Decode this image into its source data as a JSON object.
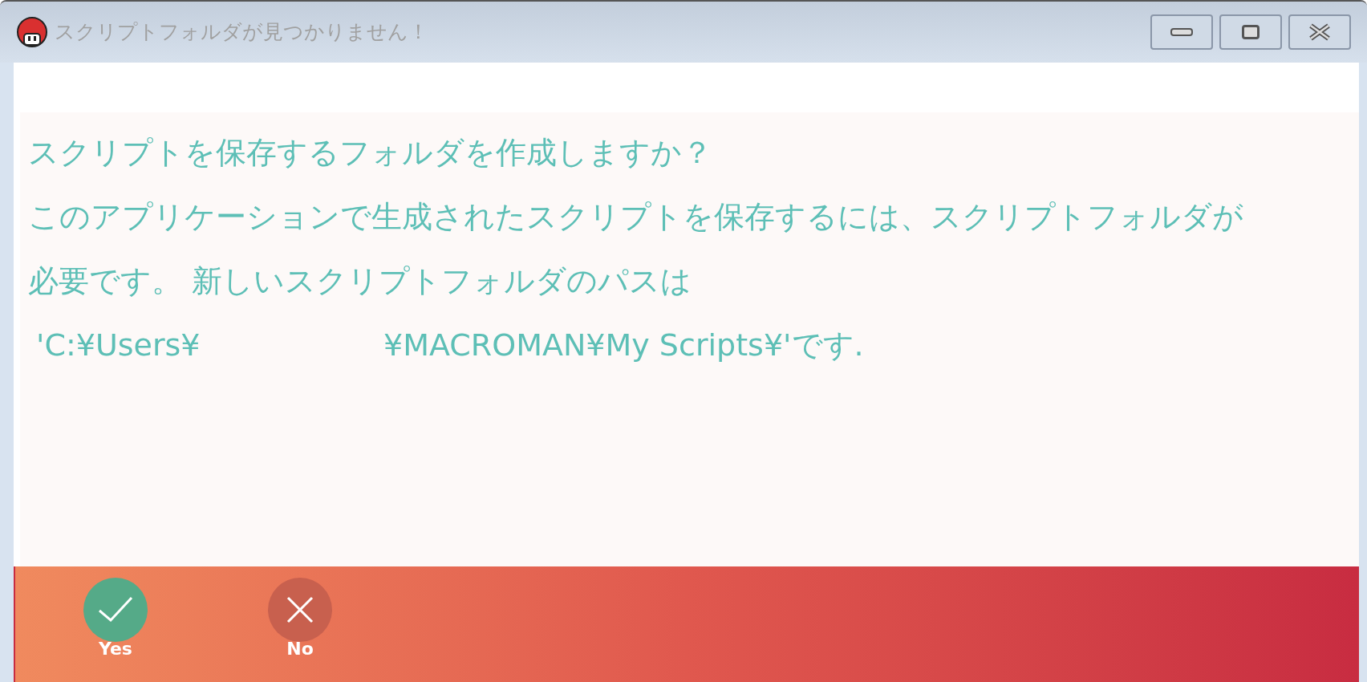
{
  "window": {
    "title": "スクリプトフォルダが見つかりません！"
  },
  "message": {
    "question": "スクリプトを保存するフォルダを作成しますか？",
    "body": "このアプリケーションで生成されたスクリプトを保存するには、スクリプトフォルダが必要です。 新しいスクリプトフォルダのパスは",
    "path_start": "'C:¥Users¥",
    "path_end": "¥MACROMAN¥My Scripts¥'です."
  },
  "buttons": [
    {
      "kind": "yes",
      "label": "Yes"
    },
    {
      "kind": "no",
      "label": "No"
    }
  ]
}
